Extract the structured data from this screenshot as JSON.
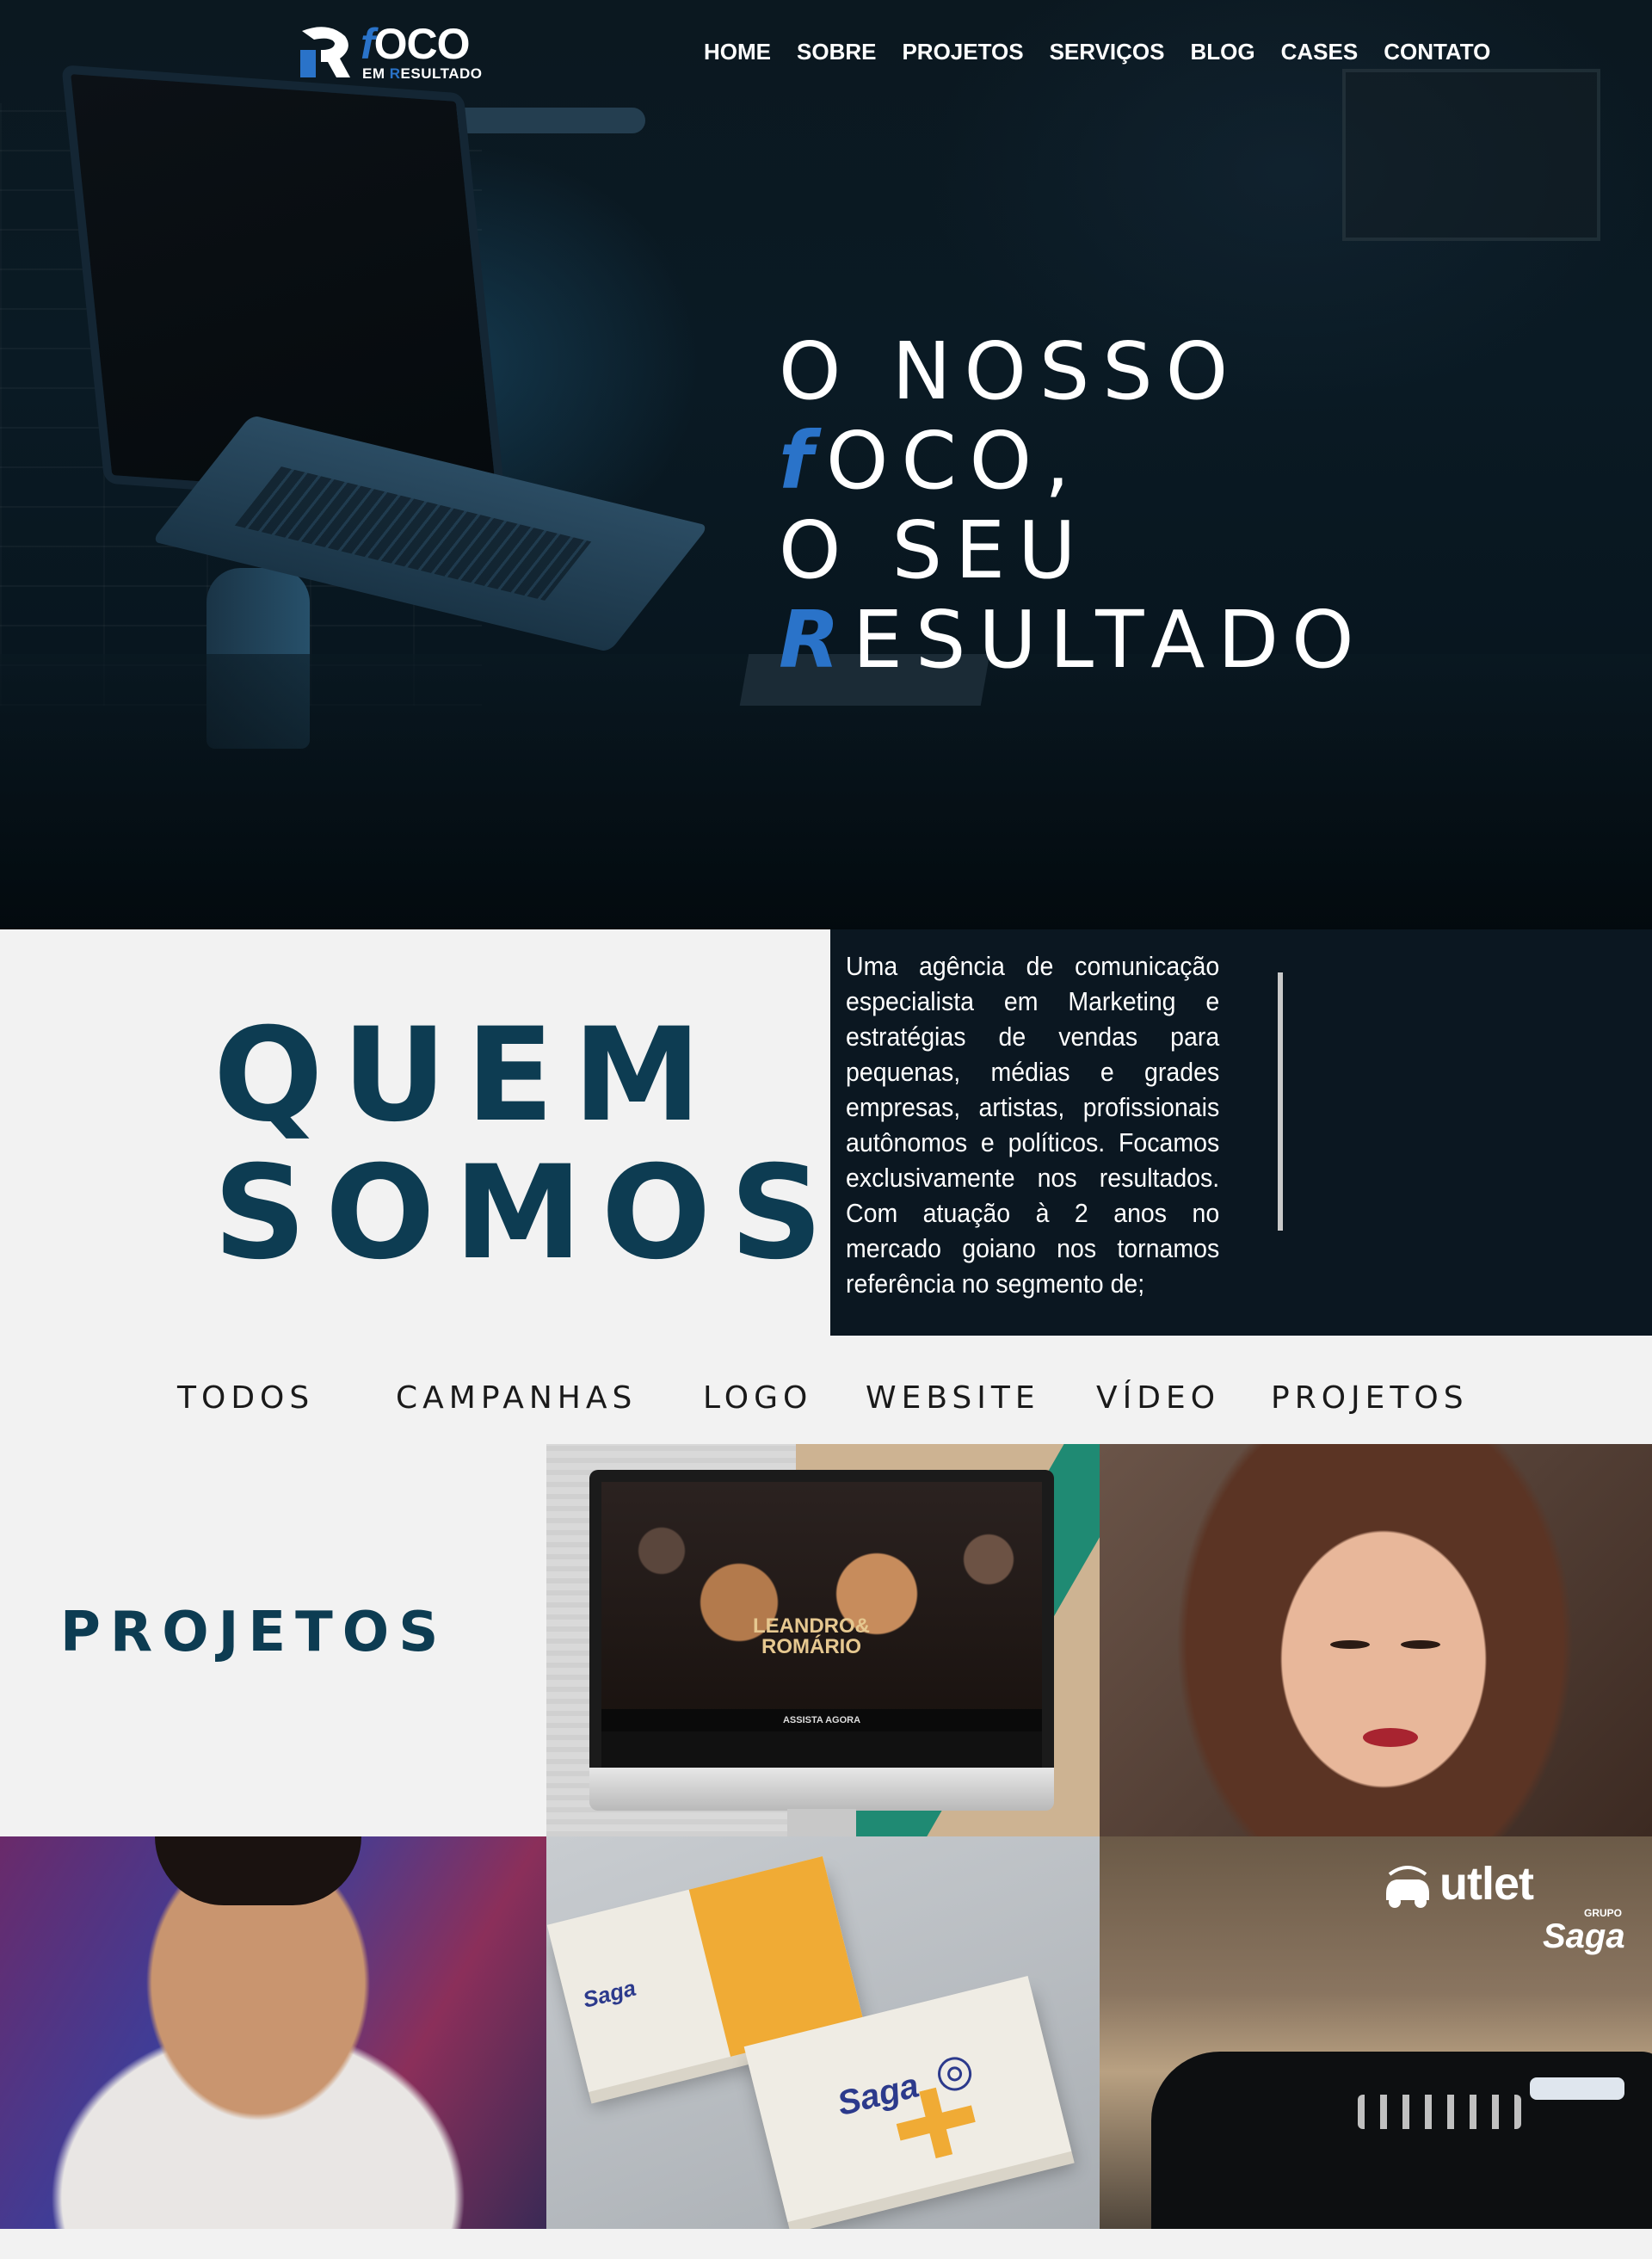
{
  "brand": {
    "logo_word_accent": "f",
    "logo_word_rest": "OCO",
    "logo_sub_prefix": "EM ",
    "logo_sub_accent": "R",
    "logo_sub_rest": "ESULTADO"
  },
  "nav": {
    "items": [
      {
        "label": "HOME"
      },
      {
        "label": "SOBRE"
      },
      {
        "label": "PROJETOS"
      },
      {
        "label": "SERVIÇOS"
      },
      {
        "label": "BLOG"
      },
      {
        "label": "CASES"
      },
      {
        "label": "CONTATO"
      }
    ]
  },
  "hero": {
    "line1": "O NOSSO",
    "line2_accent": "f",
    "line2_rest": "OCO,",
    "line3": "O SEU",
    "line4_accent": "R",
    "line4_rest": "ESULTADO"
  },
  "about": {
    "title_line1": "QUEM",
    "title_line2": "SOMOS",
    "text": "Uma agência de comunicação especialista em Marketing e estratégias de vendas para pequenas, médias e grades empresas, artistas, profissionais autônomos e políticos. Focamos exclusivamente nos resultados. Com atuação à 2 anos no mercado goiano nos tornamos referência no segmento de;"
  },
  "filters": {
    "items": [
      {
        "label": "TODOS"
      },
      {
        "label": "CAMPANHAS"
      },
      {
        "label": "LOGO"
      },
      {
        "label": "WEBSITE"
      },
      {
        "label": "VÍDEO"
      },
      {
        "label": "PROJETOS"
      }
    ]
  },
  "projects": {
    "section_label": "PROJETOS",
    "website_mockup_title_1": "LEANDRO&",
    "website_mockup_title_2": "ROMÁRIO",
    "website_mockup_cta": "ASSISTA AGORA",
    "card_brand": "Saga",
    "outlet_word": "utlet",
    "outlet_grupo": "GRUPO",
    "outlet_saga": "Saga"
  },
  "colors": {
    "accent_blue": "#2a73c9",
    "title_navy": "#0d3c52",
    "panel_dark": "#0b1721",
    "page_bg": "#f2f2f2"
  }
}
